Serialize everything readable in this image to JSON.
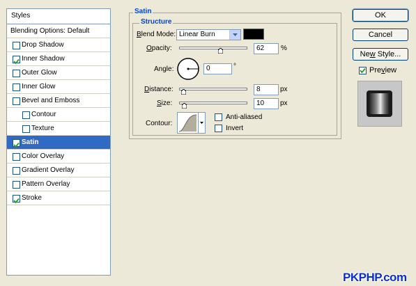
{
  "styles_list": {
    "header": "Styles",
    "blending_options": "Blending Options: Default",
    "items": [
      {
        "label": "Drop Shadow",
        "checked": false
      },
      {
        "label": "Inner Shadow",
        "checked": true
      },
      {
        "label": "Outer Glow",
        "checked": false
      },
      {
        "label": "Inner Glow",
        "checked": false
      },
      {
        "label": "Bevel and Emboss",
        "checked": false
      },
      {
        "label": "Contour",
        "checked": false
      },
      {
        "label": "Texture",
        "checked": false
      },
      {
        "label": "Satin",
        "checked": true,
        "selected": true
      },
      {
        "label": "Color Overlay",
        "checked": false
      },
      {
        "label": "Gradient Overlay",
        "checked": false
      },
      {
        "label": "Pattern Overlay",
        "checked": false
      },
      {
        "label": "Stroke",
        "checked": true
      }
    ]
  },
  "satin": {
    "title": "Satin",
    "structure": {
      "title": "Structure",
      "blend_mode": {
        "label_first": "B",
        "label_rest": "lend Mode:",
        "value": "Linear Burn"
      },
      "color": "#000000",
      "opacity": {
        "label_first": "O",
        "label_rest": "pacity:",
        "value": "62",
        "unit": "%",
        "level": 0.62
      },
      "angle": {
        "label": "Angle:",
        "value": "0",
        "unit": "°"
      },
      "distance": {
        "label_first": "D",
        "label_rest": "istance:",
        "value": "8",
        "unit": "px",
        "level": 0.03
      },
      "size": {
        "label_first": "S",
        "label_rest": "ize:",
        "value": "10",
        "unit": "px",
        "level": 0.04
      },
      "contour": {
        "label": "Contour:"
      },
      "anti_aliased": {
        "label": "Anti-aliased",
        "checked": false
      },
      "invert": {
        "label": "Invert",
        "checked": false
      }
    }
  },
  "buttons": {
    "ok": "OK",
    "cancel": "Cancel",
    "new_style_first": "Ne",
    "new_style_u": "w",
    "new_style_rest": " Style...",
    "preview_first": "Pre",
    "preview_u": "v",
    "preview_rest": "iew",
    "preview_checked": true
  },
  "watermark": "PKPHP.com",
  "colors": {
    "selection": "#316ac5",
    "legend": "#0046d5",
    "check": "#21a121",
    "watermark": "#0b2dd3"
  }
}
